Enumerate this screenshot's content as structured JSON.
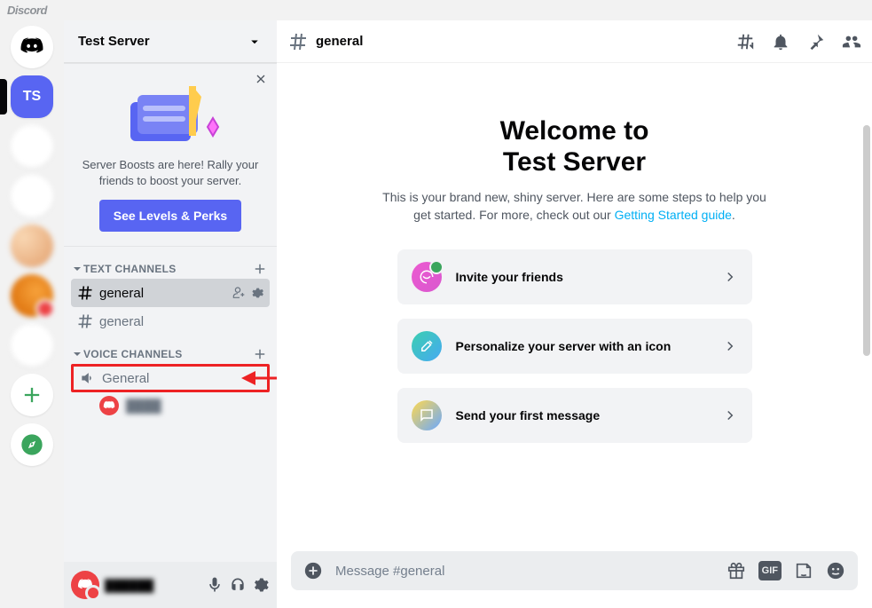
{
  "app": {
    "wordmark": "Discord"
  },
  "servers": {
    "home_icon": "discord-logo",
    "selected": {
      "initials": "TS"
    },
    "add_icon": "plus",
    "explore_icon": "compass"
  },
  "sidebar": {
    "server_name": "Test Server",
    "promo": {
      "text": "Server Boosts are here! Rally your friends to boost your server.",
      "button": "See Levels & Perks"
    },
    "categories": [
      {
        "name": "TEXT CHANNELS",
        "channels": [
          {
            "name": "general",
            "selected": true
          },
          {
            "name": "general",
            "selected": false
          }
        ]
      },
      {
        "name": "VOICE CHANNELS",
        "channels": [
          {
            "name": "General",
            "highlighted": true
          }
        ]
      }
    ],
    "user_panel": {
      "mic_icon": "mic",
      "headphones_icon": "headphones",
      "settings_icon": "gear"
    }
  },
  "chat": {
    "channel_name": "general",
    "header_icons": [
      "threads",
      "bell",
      "pin",
      "members"
    ],
    "welcome": {
      "title_line1": "Welcome to",
      "title_line2": "Test Server",
      "subtitle_pre": "This is your brand new, shiny server. Here are some steps to help you get started. For more, check out our ",
      "subtitle_link": "Getting Started guide",
      "subtitle_post": "."
    },
    "cards": [
      {
        "label": "Invite your friends"
      },
      {
        "label": "Personalize your server with an icon"
      },
      {
        "label": "Send your first message"
      }
    ],
    "composer": {
      "placeholder": "Message #general",
      "icons": {
        "gift": "gift",
        "gif": "GIF",
        "sticker": "sticker",
        "emoji": "emoji"
      }
    }
  }
}
